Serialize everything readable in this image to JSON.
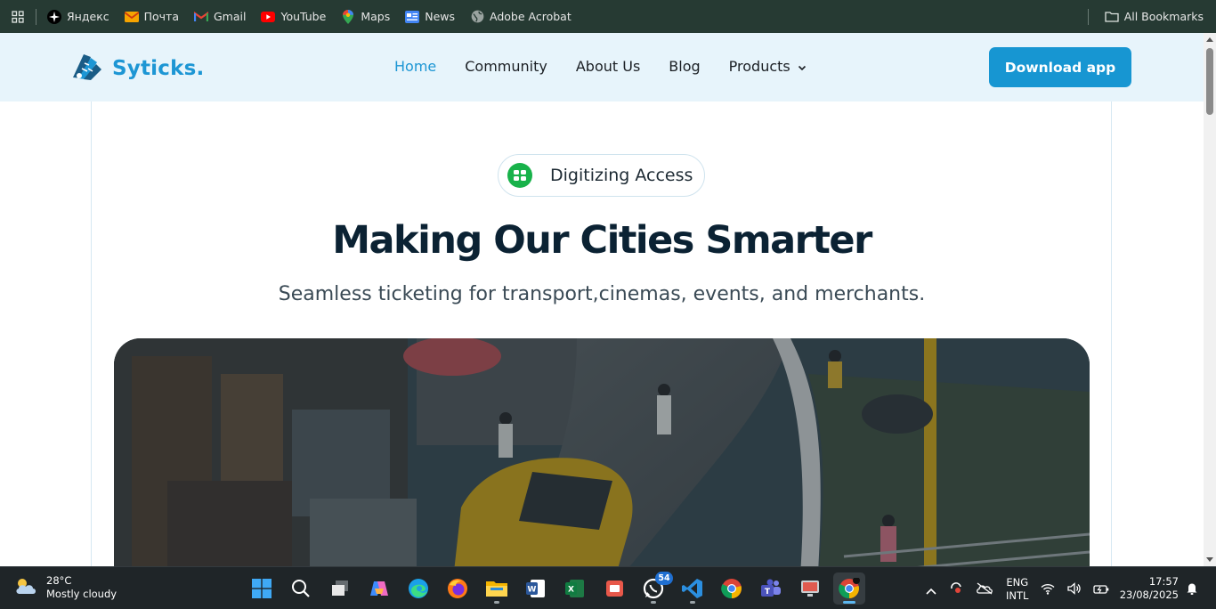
{
  "bookmarks": {
    "items": [
      {
        "label": "Яндекс",
        "icon": "yandex-icon"
      },
      {
        "label": "Почта",
        "icon": "mail-icon"
      },
      {
        "label": "Gmail",
        "icon": "gmail-icon"
      },
      {
        "label": "YouTube",
        "icon": "youtube-icon"
      },
      {
        "label": "Maps",
        "icon": "maps-icon"
      },
      {
        "label": "News",
        "icon": "news-icon"
      },
      {
        "label": "Adobe Acrobat",
        "icon": "acrobat-icon"
      }
    ],
    "all_bookmarks": "All Bookmarks"
  },
  "site": {
    "logo_text": "Syticks.",
    "nav": {
      "home": "Home",
      "community": "Community",
      "about": "About Us",
      "blog": "Blog",
      "products": "Products"
    },
    "download_button": "Download app",
    "pill_text": "Digitizing Access",
    "hero_title": "Making Our Cities Smarter",
    "hero_subtitle": "Seamless ticketing for transport,cinemas, events, and merchants."
  },
  "taskbar": {
    "weather_temp": "28°C",
    "weather_desc": "Mostly cloudy",
    "whatsapp_badge": "54",
    "lang_top": "ENG",
    "lang_bottom": "INTL",
    "time": "17:57",
    "date": "23/08/2025"
  },
  "colors": {
    "brand": "#1d96d4",
    "nav_bg": "#e7f4fb",
    "heading": "#0b2233",
    "bookmarks_bg": "#263a33",
    "taskbar_bg": "#1f2528"
  }
}
